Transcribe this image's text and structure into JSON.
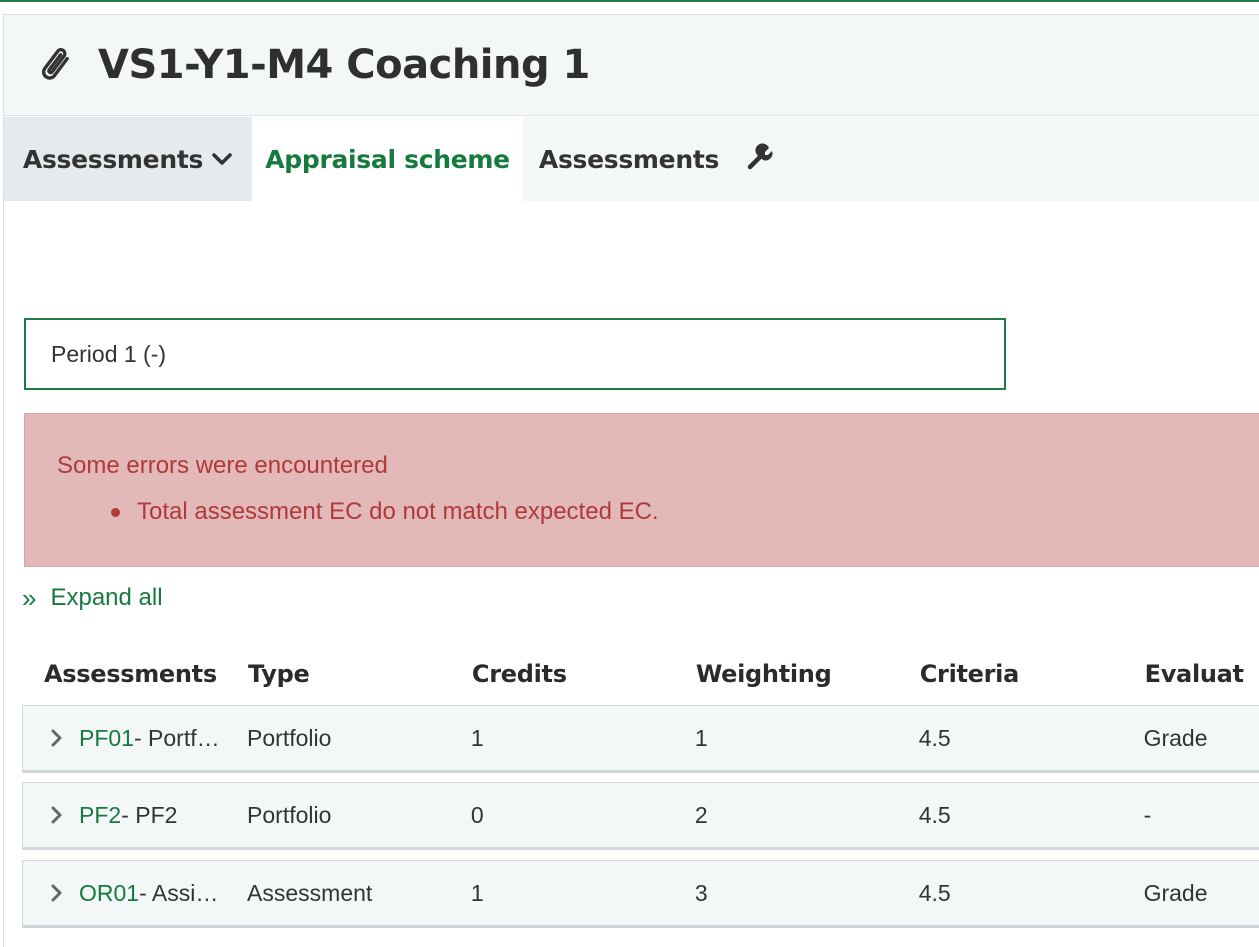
{
  "header": {
    "title": "VS1-Y1-M4 Coaching 1",
    "icon": "paperclip-icon"
  },
  "tabs": {
    "dropdown_label": "Assessments",
    "appraisal": "Appraisal scheme",
    "assessments": "Assessments",
    "settings_icon": "wrench-icon"
  },
  "period": {
    "value": "Period 1 (-)"
  },
  "alert": {
    "heading": "Some errors were encountered",
    "items": [
      "Total assessment EC do not match expected EC."
    ]
  },
  "expand_all": {
    "glyph": "»",
    "label": "Expand all"
  },
  "table": {
    "columns": [
      "Assessments",
      "Type",
      "Credits",
      "Weighting",
      "Criteria",
      "Evaluat"
    ],
    "rows": [
      {
        "code": "PF01",
        "name": " - Portf…",
        "type": "Portfolio",
        "credits": "1",
        "weighting": "1",
        "criteria": "4.5",
        "evaluation": "Grade"
      },
      {
        "code": "PF2",
        "name": " - PF2",
        "type": "Portfolio",
        "credits": "0",
        "weighting": "2",
        "criteria": "4.5",
        "evaluation": "-"
      },
      {
        "code": "OR01",
        "name": " - Assi…",
        "type": "Assessment",
        "credits": "1",
        "weighting": "3",
        "criteria": "4.5",
        "evaluation": "Grade"
      }
    ]
  },
  "colors": {
    "accent": "#157a3e",
    "alert_bg": "#e3b8b9",
    "alert_text": "#b03a3a",
    "header_bg": "#f4f7f8"
  }
}
